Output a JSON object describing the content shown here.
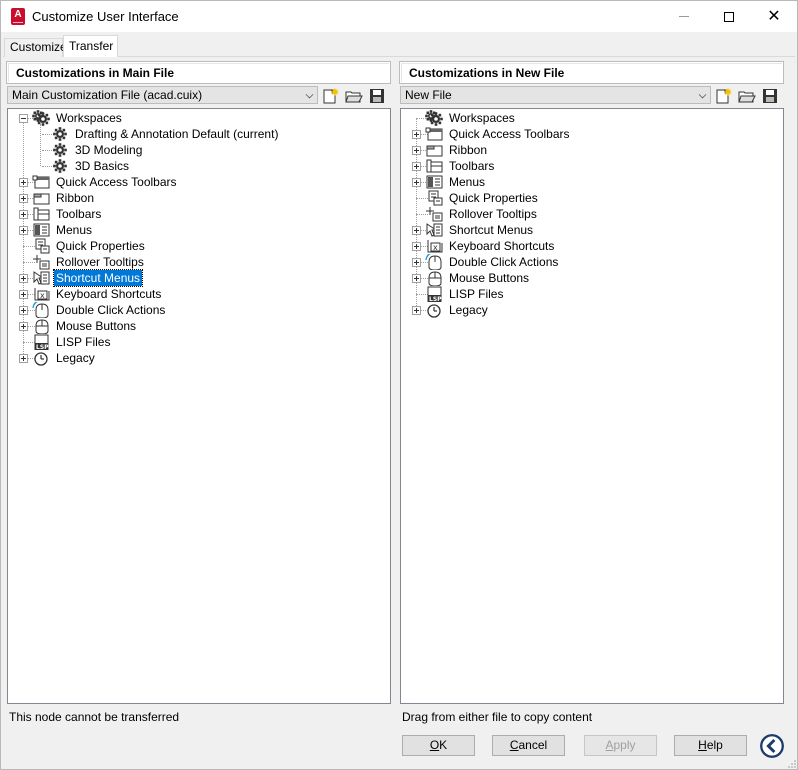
{
  "window": {
    "title": "Customize User Interface",
    "app_icon_letter": "A",
    "accent_color": "#0078d7"
  },
  "tabs": [
    {
      "label": "Customize",
      "active": false
    },
    {
      "label": "Transfer",
      "active": true
    }
  ],
  "left_panel": {
    "header": "Customizations in Main File",
    "file_selector": "Main Customization File (acad.cuix)",
    "tree": [
      {
        "label": "Workspaces",
        "icon": "workspaces-gear-icon",
        "expander": "minus",
        "level": 0
      },
      {
        "label": "Drafting & Annotation Default (current)",
        "icon": "workspace-gear-icon",
        "expander": "none",
        "level": 1
      },
      {
        "label": "3D Modeling",
        "icon": "workspace-gear-icon",
        "expander": "none",
        "level": 1
      },
      {
        "label": "3D Basics",
        "icon": "workspace-gear-icon",
        "expander": "none",
        "level": 1
      },
      {
        "label": "Quick Access Toolbars",
        "icon": "quick-access-toolbar-icon",
        "expander": "plus",
        "level": 0
      },
      {
        "label": "Ribbon",
        "icon": "ribbon-icon",
        "expander": "plus",
        "level": 0
      },
      {
        "label": "Toolbars",
        "icon": "toolbars-icon",
        "expander": "plus",
        "level": 0
      },
      {
        "label": "Menus",
        "icon": "menus-icon",
        "expander": "plus",
        "level": 0
      },
      {
        "label": "Quick Properties",
        "icon": "quick-properties-icon",
        "expander": "none",
        "level": 0
      },
      {
        "label": "Rollover Tooltips",
        "icon": "rollover-tooltips-icon",
        "expander": "none",
        "level": 0
      },
      {
        "label": "Shortcut Menus",
        "icon": "shortcut-menus-icon",
        "expander": "plus",
        "level": 0,
        "selected": true
      },
      {
        "label": "Keyboard Shortcuts",
        "icon": "keyboard-shortcuts-icon",
        "expander": "plus",
        "level": 0
      },
      {
        "label": "Double Click Actions",
        "icon": "double-click-icon",
        "expander": "plus",
        "level": 0
      },
      {
        "label": "Mouse Buttons",
        "icon": "mouse-buttons-icon",
        "expander": "plus",
        "level": 0
      },
      {
        "label": "LISP Files",
        "icon": "lisp-files-icon",
        "expander": "none",
        "level": 0
      },
      {
        "label": "Legacy",
        "icon": "legacy-clock-icon",
        "expander": "plus",
        "level": 0
      }
    ],
    "status": "This node cannot be transferred"
  },
  "right_panel": {
    "header": "Customizations in New File",
    "file_selector": "New File",
    "tree": [
      {
        "label": "Workspaces",
        "icon": "workspaces-gear-icon",
        "expander": "none",
        "level": 0
      },
      {
        "label": "Quick Access Toolbars",
        "icon": "quick-access-toolbar-icon",
        "expander": "plus",
        "level": 0
      },
      {
        "label": "Ribbon",
        "icon": "ribbon-icon",
        "expander": "plus",
        "level": 0
      },
      {
        "label": "Toolbars",
        "icon": "toolbars-icon",
        "expander": "plus",
        "level": 0
      },
      {
        "label": "Menus",
        "icon": "menus-icon",
        "expander": "plus",
        "level": 0
      },
      {
        "label": "Quick Properties",
        "icon": "quick-properties-icon",
        "expander": "none",
        "level": 0
      },
      {
        "label": "Rollover Tooltips",
        "icon": "rollover-tooltips-icon",
        "expander": "none",
        "level": 0
      },
      {
        "label": "Shortcut Menus",
        "icon": "shortcut-menus-icon",
        "expander": "plus",
        "level": 0
      },
      {
        "label": "Keyboard Shortcuts",
        "icon": "keyboard-shortcuts-icon",
        "expander": "plus",
        "level": 0
      },
      {
        "label": "Double Click Actions",
        "icon": "double-click-icon",
        "expander": "plus",
        "level": 0
      },
      {
        "label": "Mouse Buttons",
        "icon": "mouse-buttons-icon",
        "expander": "plus",
        "level": 0
      },
      {
        "label": "LISP Files",
        "icon": "lisp-files-icon",
        "expander": "none",
        "level": 0
      },
      {
        "label": "Legacy",
        "icon": "legacy-clock-icon",
        "expander": "plus",
        "level": 0
      }
    ],
    "status": "Drag from either file to copy content"
  },
  "buttons": {
    "ok": {
      "mnemonic": "O",
      "rest": "K"
    },
    "cancel": {
      "mnemonic": "C",
      "rest": "ancel"
    },
    "apply": {
      "mnemonic": "A",
      "rest": "pply"
    },
    "help": {
      "mnemonic": "H",
      "rest": "elp"
    }
  }
}
